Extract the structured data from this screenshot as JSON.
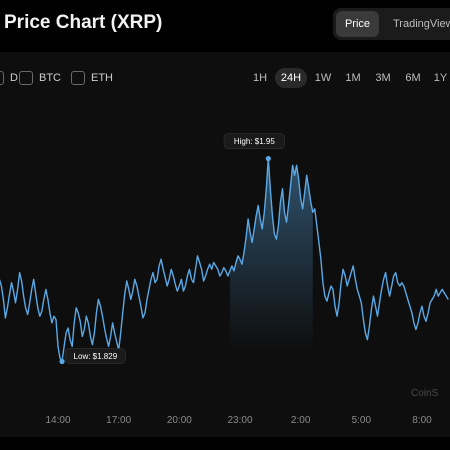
{
  "header": {
    "title": "Price Chart (XRP)",
    "view_toggle": {
      "active": "Price",
      "inactive": "TradingView"
    }
  },
  "compare": {
    "items": [
      {
        "label": "D",
        "checked": false
      },
      {
        "label": "BTC",
        "checked": false
      },
      {
        "label": "ETH",
        "checked": false
      }
    ]
  },
  "ranges": {
    "items": [
      "1H",
      "24H",
      "1W",
      "1M",
      "3M",
      "6M",
      "1Y"
    ],
    "active": "24H"
  },
  "watermark": "CoinS",
  "colors": {
    "line": "#5aa9e6",
    "background": "#0e0e0e",
    "tooltip_bg": "#1a1a1a"
  },
  "chart_data": {
    "type": "line",
    "title": "Price Chart (XRP)",
    "xlabel": "",
    "ylabel": "",
    "x_ticks": [
      "14:00",
      "17:00",
      "20:00",
      "23:00",
      "2:00",
      "5:00",
      "8:00"
    ],
    "annotations": {
      "high": "High: $1.95",
      "low": "Low: $1.829"
    },
    "ylim": [
      1.815,
      1.97
    ],
    "high_value": 1.95,
    "low_value": 1.829,
    "x_hours": [
      10.5,
      10.6,
      10.7,
      10.8,
      10.9,
      11.0,
      11.1,
      11.2,
      11.3,
      11.4,
      11.5,
      11.6,
      11.7,
      11.8,
      11.9,
      12.0,
      12.1,
      12.2,
      12.3,
      12.4,
      12.5,
      12.6,
      12.7,
      12.8,
      12.9,
      13.0,
      13.1,
      13.2,
      13.3,
      13.4,
      13.5,
      13.6,
      13.7,
      13.8,
      13.9,
      14.0,
      14.1,
      14.2,
      14.3,
      14.4,
      14.5,
      14.6,
      14.7,
      14.8,
      14.9,
      15.0,
      15.1,
      15.2,
      15.3,
      15.4,
      15.5,
      15.6,
      15.7,
      15.8,
      15.9,
      16.0,
      16.1,
      16.2,
      16.3,
      16.4,
      16.5,
      16.6,
      16.7,
      16.8,
      16.9,
      17.0,
      17.1,
      17.2,
      17.3,
      17.4,
      17.5,
      17.6,
      17.7,
      17.8,
      17.9,
      18.0,
      18.1,
      18.2,
      18.3,
      18.4,
      18.5,
      18.6,
      18.7,
      18.8,
      18.9,
      19.0,
      19.1,
      19.2,
      19.3,
      19.4,
      19.5,
      19.6,
      19.7,
      19.8,
      19.9,
      20.0,
      20.1,
      20.2,
      20.3,
      20.4,
      20.5,
      20.6,
      20.7,
      20.8,
      20.9,
      21.0,
      21.1,
      21.2,
      21.3,
      21.4,
      21.5,
      21.6,
      21.7,
      21.8,
      21.9,
      22.0,
      22.1,
      22.2,
      22.3,
      22.4,
      22.5,
      22.6,
      22.7,
      22.8,
      22.9,
      23.0,
      23.1,
      23.2,
      23.3,
      23.4,
      23.5,
      23.6,
      23.7,
      23.8,
      23.9,
      24.0,
      24.1,
      24.2,
      24.3,
      24.4,
      24.5,
      24.6,
      24.7,
      24.8,
      24.9,
      25.0,
      25.1,
      25.2,
      25.3,
      25.4,
      25.5,
      25.6,
      25.7,
      25.8,
      25.9,
      26.0,
      26.1,
      26.2,
      26.3,
      26.4,
      26.5,
      26.6,
      26.7,
      26.8,
      26.9,
      27.0,
      27.1,
      27.2,
      27.3,
      27.4,
      27.5,
      27.6,
      27.7,
      27.8,
      27.9,
      28.0,
      28.1,
      28.2,
      28.3,
      28.4,
      28.5,
      28.6,
      28.7,
      28.8,
      28.9,
      29.0,
      29.1,
      29.2,
      29.3,
      29.4,
      29.5,
      29.6,
      29.7,
      29.8,
      29.9,
      30.0,
      30.1,
      30.2,
      30.3,
      30.4,
      30.5,
      30.6,
      30.7,
      30.8,
      30.9,
      31.0,
      31.1,
      31.2,
      31.3,
      31.4,
      31.5,
      31.6,
      31.7,
      31.8,
      31.9,
      32.0,
      32.1,
      32.2,
      32.3,
      32.4,
      32.5,
      32.6,
      32.7,
      32.8,
      32.9,
      33.0,
      33.1,
      33.2,
      33.3,
      33.4,
      33.5,
      33.6,
      33.7,
      33.8,
      33.9,
      34.0,
      34.1,
      34.2,
      34.3,
      34.4,
      34.5
    ],
    "x_tick_hours": [
      14,
      17,
      20,
      23,
      26,
      29,
      32
    ],
    "values": [
      1.888,
      1.879,
      1.886,
      1.875,
      1.872,
      1.876,
      1.878,
      1.874,
      1.866,
      1.855,
      1.861,
      1.869,
      1.876,
      1.871,
      1.864,
      1.872,
      1.882,
      1.877,
      1.868,
      1.861,
      1.857,
      1.864,
      1.872,
      1.878,
      1.869,
      1.861,
      1.856,
      1.859,
      1.866,
      1.872,
      1.866,
      1.858,
      1.852,
      1.856,
      1.854,
      1.838,
      1.831,
      1.829,
      1.838,
      1.846,
      1.849,
      1.842,
      1.838,
      1.852,
      1.861,
      1.858,
      1.853,
      1.844,
      1.848,
      1.856,
      1.852,
      1.844,
      1.839,
      1.846,
      1.858,
      1.866,
      1.862,
      1.856,
      1.849,
      1.843,
      1.838,
      1.844,
      1.852,
      1.846,
      1.841,
      1.836,
      1.846,
      1.858,
      1.869,
      1.877,
      1.872,
      1.866,
      1.871,
      1.878,
      1.874,
      1.868,
      1.862,
      1.855,
      1.858,
      1.866,
      1.872,
      1.878,
      1.882,
      1.876,
      1.878,
      1.886,
      1.89,
      1.884,
      1.879,
      1.874,
      1.878,
      1.884,
      1.88,
      1.875,
      1.871,
      1.874,
      1.878,
      1.871,
      1.874,
      1.88,
      1.884,
      1.878,
      1.876,
      1.884,
      1.892,
      1.888,
      1.884,
      1.877,
      1.88,
      1.884,
      1.887,
      1.884,
      1.888,
      1.886,
      1.884,
      1.88,
      1.882,
      1.885,
      1.883,
      1.88,
      1.883,
      1.886,
      1.883,
      1.888,
      1.892,
      1.89,
      1.887,
      1.894,
      1.903,
      1.914,
      1.906,
      1.9,
      1.908,
      1.916,
      1.922,
      1.914,
      1.908,
      1.918,
      1.932,
      1.95,
      1.932,
      1.916,
      1.905,
      1.902,
      1.91,
      1.924,
      1.932,
      1.918,
      1.912,
      1.922,
      1.934,
      1.946,
      1.94,
      1.946,
      1.938,
      1.926,
      1.92,
      1.93,
      1.94,
      1.932,
      1.924,
      1.918,
      1.92,
      1.91,
      1.9,
      1.89,
      1.876,
      1.868,
      1.865,
      1.87,
      1.874,
      1.872,
      1.862,
      1.856,
      1.864,
      1.876,
      1.884,
      1.88,
      1.874,
      1.878,
      1.882,
      1.886,
      1.878,
      1.872,
      1.868,
      1.864,
      1.854,
      1.846,
      1.842,
      1.85,
      1.86,
      1.868,
      1.862,
      1.856,
      1.864,
      1.872,
      1.878,
      1.882,
      1.874,
      1.868,
      1.874,
      1.88,
      1.882,
      1.876,
      1.874,
      1.876,
      1.874,
      1.87,
      1.866,
      1.862,
      1.858,
      1.852,
      1.848,
      1.852,
      1.858,
      1.862,
      1.856,
      1.853,
      1.858,
      1.864,
      1.866,
      1.868,
      1.872,
      1.868,
      1.87,
      1.872,
      1.87,
      1.868,
      1.866
    ]
  }
}
